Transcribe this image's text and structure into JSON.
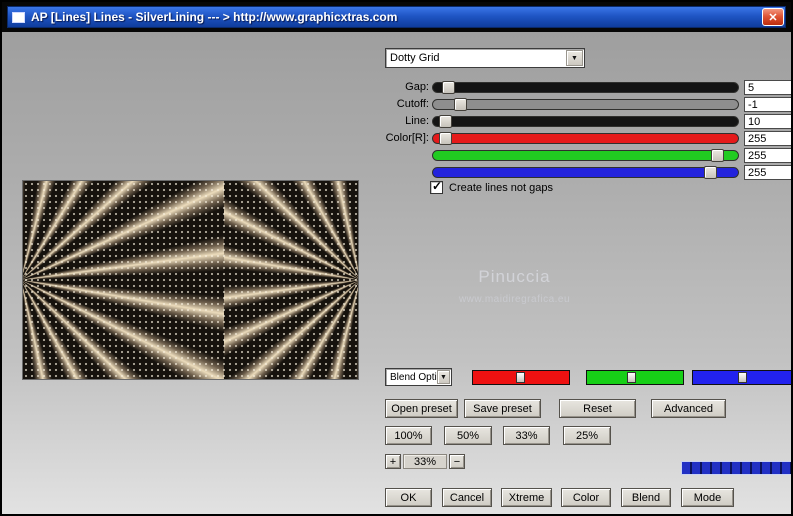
{
  "titlebar": {
    "title": "AP [Lines]  Lines - SilverLining    --- > http://www.graphicxtras.com",
    "close_glyph": "✕"
  },
  "icons": {
    "dropdown_arrow": "▼"
  },
  "preset_select": {
    "value": "Dotty Grid"
  },
  "params": {
    "rows": [
      {
        "label": "Gap:",
        "value": "5",
        "track_color": "#141414",
        "knob_left": "3%"
      },
      {
        "label": "Cutoff:",
        "value": "-1",
        "track_color": "#8e8e8e",
        "knob_left": "7%"
      },
      {
        "label": "Line:",
        "value": "10",
        "track_color": "#141414",
        "knob_left": "2%"
      },
      {
        "label": "Color[R]:",
        "value": "255",
        "track_color": "#e51a1a",
        "knob_left": "2%"
      },
      {
        "label": "",
        "value": "255",
        "track_color": "#21cb21",
        "knob_left": "91%"
      },
      {
        "label": "",
        "value": "255",
        "track_color": "#2323dd",
        "knob_left": "89%"
      }
    ]
  },
  "checkbox": {
    "label": "Create lines not gaps",
    "checked": true,
    "check_glyph": "✓"
  },
  "watermark": {
    "line1": "Pinuccia",
    "line2": "www.maidiregrafica.eu"
  },
  "blend_select": {
    "value": "Blend Opti"
  },
  "channels": [
    {
      "name": "red",
      "color": "#ee1111",
      "thumb_left": "45%"
    },
    {
      "name": "green",
      "color": "#17cf17",
      "thumb_left": "42%"
    },
    {
      "name": "blue",
      "color": "#2222ee",
      "thumb_left": "46%"
    }
  ],
  "buttons": {
    "open_preset": "Open preset",
    "save_preset": "Save preset",
    "reset": "Reset",
    "advanced": "Advanced",
    "zoom_100": "100%",
    "zoom_50": "50%",
    "zoom_33": "33%",
    "zoom_25": "25%",
    "plus": "+",
    "minus": "−",
    "ok": "OK",
    "cancel": "Cancel",
    "xtreme": "Xtreme",
    "color": "Color",
    "blend": "Blend",
    "mode": "Mode"
  },
  "zoom_display": "33%",
  "progress": {
    "color": "#2130c4"
  }
}
